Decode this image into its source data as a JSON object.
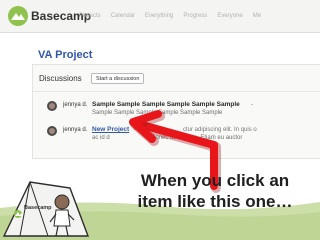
{
  "app": {
    "brand": "Basecamp"
  },
  "nav": [
    "Projects",
    "Calendar",
    "Everything",
    "Progress",
    "Everyone",
    "Me"
  ],
  "project": {
    "title": "VA Project"
  },
  "discussions": {
    "heading": "Discussions",
    "start_button": "Start a discussion",
    "items": [
      {
        "author": "jennya d.",
        "subject": "Sample Sample Sample Sample Sample Sample",
        "dash": "-",
        "excerpt": "Sample Sample Sample Sample Sample Sample"
      },
      {
        "author": "jennya d.",
        "subject": "New Project",
        "dash": "- L",
        "excerpt": "ac id d",
        "excerpt_tail": "ctur adipiscing elit. In quis o",
        "excerpt_tail2": "Donec          tur at eros. Etiam eu auctor"
      }
    ]
  },
  "tent": {
    "label": "Basecamp"
  },
  "caption": {
    "line1": "When you click an",
    "line2": "item like this one…"
  },
  "colors": {
    "link": "#2f56a8",
    "arrow": "#e8161a",
    "logo": "#8fc24f",
    "grass": "#cddfa8"
  },
  "icons": {
    "logo": "basecamp-mountain-logo",
    "arrow": "red-pointer-arrow",
    "avatar": "user-avatar"
  }
}
